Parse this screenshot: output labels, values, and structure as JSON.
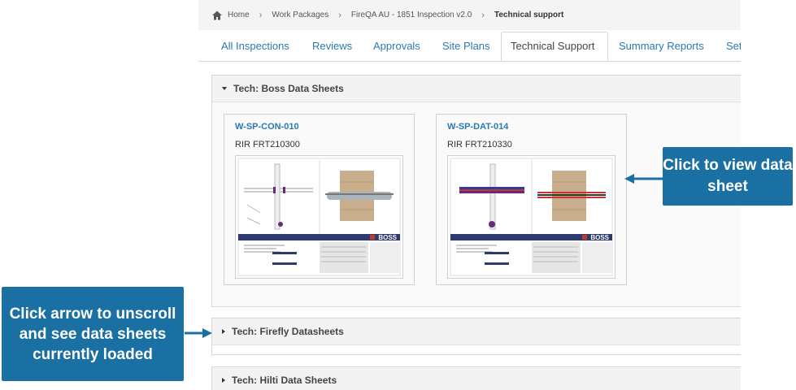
{
  "breadcrumb": {
    "home": "Home",
    "work_packages": "Work Packages",
    "inspection": "FireQA AU - 1851 Inspection v2.0",
    "current": "Technical support"
  },
  "tabs": [
    {
      "label": "All Inspections"
    },
    {
      "label": "Reviews"
    },
    {
      "label": "Approvals"
    },
    {
      "label": "Site Plans"
    },
    {
      "label": "Technical Support",
      "active": true
    },
    {
      "label": "Summary Reports"
    },
    {
      "label": "Settings"
    }
  ],
  "sections": [
    {
      "title": "Tech: Boss Data Sheets",
      "expanded": true,
      "cards": [
        {
          "code": "W-SP-CON-010",
          "ref": "RIR FRT210300"
        },
        {
          "code": "W-SP-DAT-014",
          "ref": "RIR FRT210330"
        }
      ]
    },
    {
      "title": "Tech: Firefly Datasheets",
      "expanded": false
    },
    {
      "title": "Tech: Hilti Data Sheets",
      "expanded": false
    }
  ],
  "thumbnail_brand": "BOSS",
  "callouts": {
    "view": "Click to view data sheet",
    "scroll": "Click arrow to unscroll and see data sheets currently loaded"
  },
  "colors": {
    "accent": "#2a7ab0",
    "callout": "#1a6fa3"
  }
}
